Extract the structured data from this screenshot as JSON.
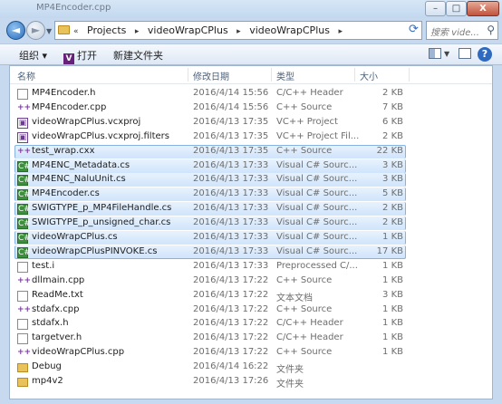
{
  "window": {
    "title": "MP4Encoder.cpp",
    "close_label": "X",
    "max_label": "□",
    "min_label": "–"
  },
  "nav": {
    "back_glyph": "◄",
    "fwd_glyph": "►"
  },
  "address": {
    "crumbs": [
      "«",
      "Projects",
      "▸",
      "videoWrapCPlus",
      "▸",
      "videoWrapCPlus",
      "▸"
    ]
  },
  "search": {
    "placeholder": "搜索 vide..."
  },
  "toolbar": {
    "organize": "组织 ▾",
    "open": "打开",
    "new_folder": "新建文件夹",
    "vs_glyph": "V"
  },
  "columns": {
    "name": "名称",
    "date": "修改日期",
    "type": "类型",
    "size": "大小"
  },
  "files": [
    {
      "name": "MP4Encoder.h",
      "date": "2016/4/14 15:56",
      "type": "C/C++ Header",
      "size": "2 KB",
      "icon": "header-file-icon",
      "glyph": "",
      "selected": false
    },
    {
      "name": "MP4Encoder.cpp",
      "date": "2016/4/14 15:56",
      "type": "C++ Source",
      "size": "7 KB",
      "icon": "cpp-file-icon",
      "glyph": "++",
      "selected": false
    },
    {
      "name": "videoWrapCPlus.vcxproj",
      "date": "2016/4/13 17:35",
      "type": "VC++ Project",
      "size": "6 KB",
      "icon": "vcxproj-file-icon",
      "glyph": "▣",
      "selected": false
    },
    {
      "name": "videoWrapCPlus.vcxproj.filters",
      "date": "2016/4/13 17:35",
      "type": "VC++ Project Fil...",
      "size": "2 KB",
      "icon": "vcxproj-filters-file-icon",
      "glyph": "▣",
      "selected": false
    },
    {
      "name": "test_wrap.cxx",
      "date": "2016/4/13 17:35",
      "type": "C++ Source",
      "size": "22 KB",
      "icon": "cxx-file-icon",
      "glyph": "++",
      "selected": true
    },
    {
      "name": "MP4ENC_Metadata.cs",
      "date": "2016/4/13 17:33",
      "type": "Visual C# Sourc...",
      "size": "3 KB",
      "icon": "cs-file-icon",
      "glyph": "C#",
      "selected": true
    },
    {
      "name": "MP4ENC_NaluUnit.cs",
      "date": "2016/4/13 17:33",
      "type": "Visual C# Sourc...",
      "size": "3 KB",
      "icon": "cs-file-icon",
      "glyph": "C#",
      "selected": true
    },
    {
      "name": "MP4Encoder.cs",
      "date": "2016/4/13 17:33",
      "type": "Visual C# Sourc...",
      "size": "5 KB",
      "icon": "cs-file-icon",
      "glyph": "C#",
      "selected": true
    },
    {
      "name": "SWIGTYPE_p_MP4FileHandle.cs",
      "date": "2016/4/13 17:33",
      "type": "Visual C# Sourc...",
      "size": "2 KB",
      "icon": "cs-file-icon",
      "glyph": "C#",
      "selected": true
    },
    {
      "name": "SWIGTYPE_p_unsigned_char.cs",
      "date": "2016/4/13 17:33",
      "type": "Visual C# Sourc...",
      "size": "2 KB",
      "icon": "cs-file-icon",
      "glyph": "C#",
      "selected": true
    },
    {
      "name": "videoWrapCPlus.cs",
      "date": "2016/4/13 17:33",
      "type": "Visual C# Sourc...",
      "size": "1 KB",
      "icon": "cs-file-icon",
      "glyph": "C#",
      "selected": true
    },
    {
      "name": "videoWrapCPlusPINVOKE.cs",
      "date": "2016/4/13 17:33",
      "type": "Visual C# Sourc...",
      "size": "17 KB",
      "icon": "cs-file-icon",
      "glyph": "C#",
      "selected": true
    },
    {
      "name": "test.i",
      "date": "2016/4/13 17:33",
      "type": "Preprocessed C/...",
      "size": "1 KB",
      "icon": "preprocessed-file-icon",
      "glyph": "",
      "selected": false
    },
    {
      "name": "dllmain.cpp",
      "date": "2016/4/13 17:22",
      "type": "C++ Source",
      "size": "1 KB",
      "icon": "cpp-file-icon",
      "glyph": "++",
      "selected": false
    },
    {
      "name": "ReadMe.txt",
      "date": "2016/4/13 17:22",
      "type": "文本文档",
      "size": "3 KB",
      "icon": "text-file-icon",
      "glyph": "",
      "selected": false
    },
    {
      "name": "stdafx.cpp",
      "date": "2016/4/13 17:22",
      "type": "C++ Source",
      "size": "1 KB",
      "icon": "cpp-file-icon",
      "glyph": "++",
      "selected": false
    },
    {
      "name": "stdafx.h",
      "date": "2016/4/13 17:22",
      "type": "C/C++ Header",
      "size": "1 KB",
      "icon": "header-file-icon",
      "glyph": "",
      "selected": false
    },
    {
      "name": "targetver.h",
      "date": "2016/4/13 17:22",
      "type": "C/C++ Header",
      "size": "1 KB",
      "icon": "header-file-icon",
      "glyph": "",
      "selected": false
    },
    {
      "name": "videoWrapCPlus.cpp",
      "date": "2016/4/13 17:22",
      "type": "C++ Source",
      "size": "1 KB",
      "icon": "cpp-file-icon",
      "glyph": "++",
      "selected": false
    },
    {
      "name": "Debug",
      "date": "2016/4/14 16:22",
      "type": "文件夹",
      "size": "",
      "icon": "folder-icon",
      "glyph": "",
      "selected": false
    },
    {
      "name": "mp4v2",
      "date": "2016/4/13 17:26",
      "type": "文件夹",
      "size": "",
      "icon": "folder-icon",
      "glyph": "",
      "selected": false
    }
  ]
}
